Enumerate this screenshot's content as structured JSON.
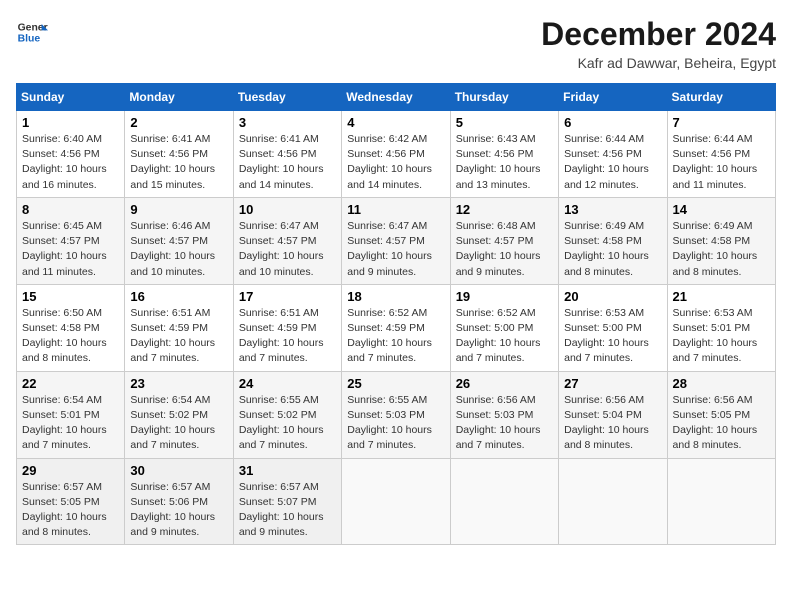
{
  "header": {
    "logo_general": "General",
    "logo_blue": "Blue",
    "month_title": "December 2024",
    "location": "Kafr ad Dawwar, Beheira, Egypt"
  },
  "weekdays": [
    "Sunday",
    "Monday",
    "Tuesday",
    "Wednesday",
    "Thursday",
    "Friday",
    "Saturday"
  ],
  "weeks": [
    [
      {
        "day": "1",
        "detail": "Sunrise: 6:40 AM\nSunset: 4:56 PM\nDaylight: 10 hours and 16 minutes."
      },
      {
        "day": "2",
        "detail": "Sunrise: 6:41 AM\nSunset: 4:56 PM\nDaylight: 10 hours and 15 minutes."
      },
      {
        "day": "3",
        "detail": "Sunrise: 6:41 AM\nSunset: 4:56 PM\nDaylight: 10 hours and 14 minutes."
      },
      {
        "day": "4",
        "detail": "Sunrise: 6:42 AM\nSunset: 4:56 PM\nDaylight: 10 hours and 14 minutes."
      },
      {
        "day": "5",
        "detail": "Sunrise: 6:43 AM\nSunset: 4:56 PM\nDaylight: 10 hours and 13 minutes."
      },
      {
        "day": "6",
        "detail": "Sunrise: 6:44 AM\nSunset: 4:56 PM\nDaylight: 10 hours and 12 minutes."
      },
      {
        "day": "7",
        "detail": "Sunrise: 6:44 AM\nSunset: 4:56 PM\nDaylight: 10 hours and 11 minutes."
      }
    ],
    [
      {
        "day": "8",
        "detail": "Sunrise: 6:45 AM\nSunset: 4:57 PM\nDaylight: 10 hours and 11 minutes."
      },
      {
        "day": "9",
        "detail": "Sunrise: 6:46 AM\nSunset: 4:57 PM\nDaylight: 10 hours and 10 minutes."
      },
      {
        "day": "10",
        "detail": "Sunrise: 6:47 AM\nSunset: 4:57 PM\nDaylight: 10 hours and 10 minutes."
      },
      {
        "day": "11",
        "detail": "Sunrise: 6:47 AM\nSunset: 4:57 PM\nDaylight: 10 hours and 9 minutes."
      },
      {
        "day": "12",
        "detail": "Sunrise: 6:48 AM\nSunset: 4:57 PM\nDaylight: 10 hours and 9 minutes."
      },
      {
        "day": "13",
        "detail": "Sunrise: 6:49 AM\nSunset: 4:58 PM\nDaylight: 10 hours and 8 minutes."
      },
      {
        "day": "14",
        "detail": "Sunrise: 6:49 AM\nSunset: 4:58 PM\nDaylight: 10 hours and 8 minutes."
      }
    ],
    [
      {
        "day": "15",
        "detail": "Sunrise: 6:50 AM\nSunset: 4:58 PM\nDaylight: 10 hours and 8 minutes."
      },
      {
        "day": "16",
        "detail": "Sunrise: 6:51 AM\nSunset: 4:59 PM\nDaylight: 10 hours and 7 minutes."
      },
      {
        "day": "17",
        "detail": "Sunrise: 6:51 AM\nSunset: 4:59 PM\nDaylight: 10 hours and 7 minutes."
      },
      {
        "day": "18",
        "detail": "Sunrise: 6:52 AM\nSunset: 4:59 PM\nDaylight: 10 hours and 7 minutes."
      },
      {
        "day": "19",
        "detail": "Sunrise: 6:52 AM\nSunset: 5:00 PM\nDaylight: 10 hours and 7 minutes."
      },
      {
        "day": "20",
        "detail": "Sunrise: 6:53 AM\nSunset: 5:00 PM\nDaylight: 10 hours and 7 minutes."
      },
      {
        "day": "21",
        "detail": "Sunrise: 6:53 AM\nSunset: 5:01 PM\nDaylight: 10 hours and 7 minutes."
      }
    ],
    [
      {
        "day": "22",
        "detail": "Sunrise: 6:54 AM\nSunset: 5:01 PM\nDaylight: 10 hours and 7 minutes."
      },
      {
        "day": "23",
        "detail": "Sunrise: 6:54 AM\nSunset: 5:02 PM\nDaylight: 10 hours and 7 minutes."
      },
      {
        "day": "24",
        "detail": "Sunrise: 6:55 AM\nSunset: 5:02 PM\nDaylight: 10 hours and 7 minutes."
      },
      {
        "day": "25",
        "detail": "Sunrise: 6:55 AM\nSunset: 5:03 PM\nDaylight: 10 hours and 7 minutes."
      },
      {
        "day": "26",
        "detail": "Sunrise: 6:56 AM\nSunset: 5:03 PM\nDaylight: 10 hours and 7 minutes."
      },
      {
        "day": "27",
        "detail": "Sunrise: 6:56 AM\nSunset: 5:04 PM\nDaylight: 10 hours and 8 minutes."
      },
      {
        "day": "28",
        "detail": "Sunrise: 6:56 AM\nSunset: 5:05 PM\nDaylight: 10 hours and 8 minutes."
      }
    ],
    [
      {
        "day": "29",
        "detail": "Sunrise: 6:57 AM\nSunset: 5:05 PM\nDaylight: 10 hours and 8 minutes."
      },
      {
        "day": "30",
        "detail": "Sunrise: 6:57 AM\nSunset: 5:06 PM\nDaylight: 10 hours and 9 minutes."
      },
      {
        "day": "31",
        "detail": "Sunrise: 6:57 AM\nSunset: 5:07 PM\nDaylight: 10 hours and 9 minutes."
      },
      null,
      null,
      null,
      null
    ]
  ]
}
